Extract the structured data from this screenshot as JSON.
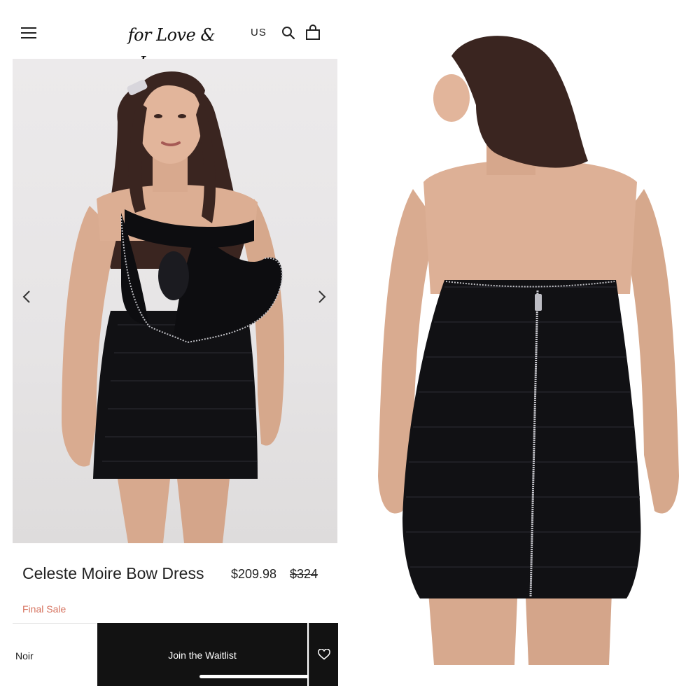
{
  "header": {
    "logo_text": "for Love & Lemons",
    "region": "US",
    "icons": [
      "menu-icon",
      "search-icon",
      "shopping-bag-icon"
    ]
  },
  "gallery": {
    "icons": [
      "chevron-left-icon",
      "chevron-right-icon"
    ]
  },
  "product": {
    "name": "Celeste Moire Bow Dress",
    "price": "$209.98",
    "compare_price": "$324",
    "sale_label": "Final Sale"
  },
  "actions": {
    "color": "Noir",
    "waitlist_label": "Join the Waitlist",
    "wishlist_icon": "heart-icon"
  },
  "colors": {
    "sale_accent": "#d6735f",
    "button_bg": "#121212"
  }
}
